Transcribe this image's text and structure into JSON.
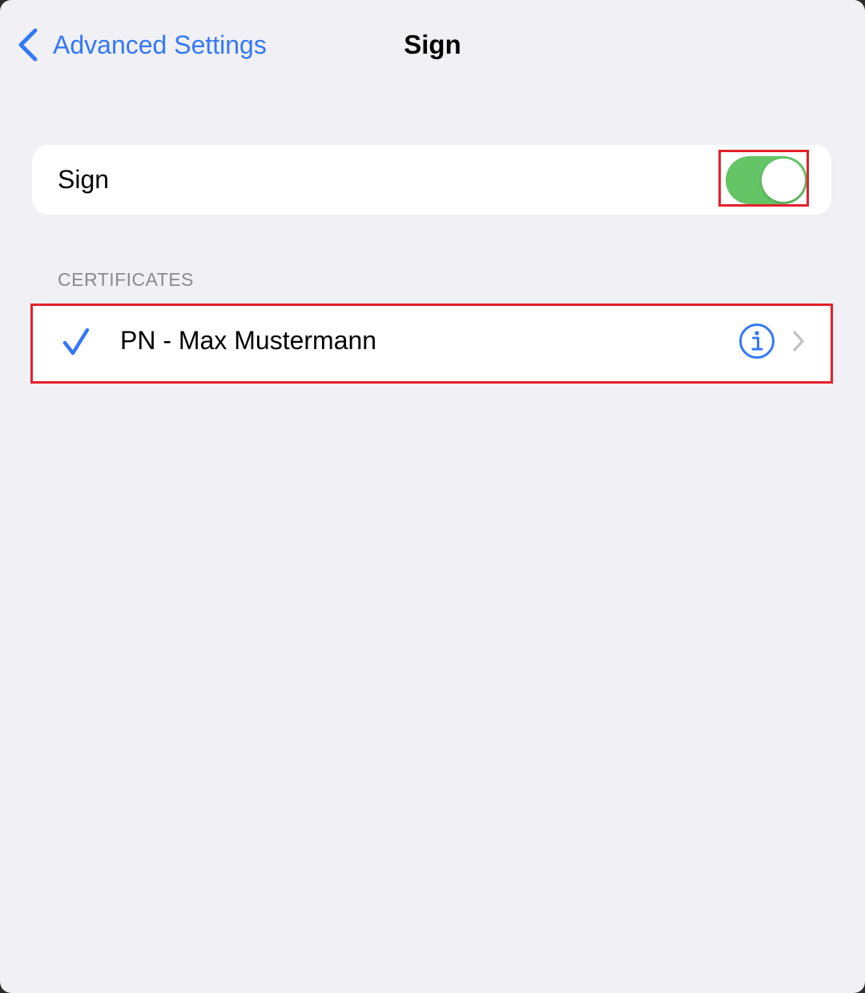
{
  "nav": {
    "back_label": "Advanced Settings",
    "title": "Sign"
  },
  "sign_toggle": {
    "label": "Sign",
    "on": true,
    "on_color": "#65c466"
  },
  "certificates": {
    "header": "CERTIFICATES",
    "items": [
      {
        "label": "PN - Max Mustermann",
        "selected": true,
        "icons": [
          "checkmark-icon",
          "info-icon",
          "chevron-right-icon"
        ]
      }
    ]
  },
  "colors": {
    "accent": "#3478f6",
    "background": "#f0f0f5",
    "highlight": "#e3202a"
  }
}
